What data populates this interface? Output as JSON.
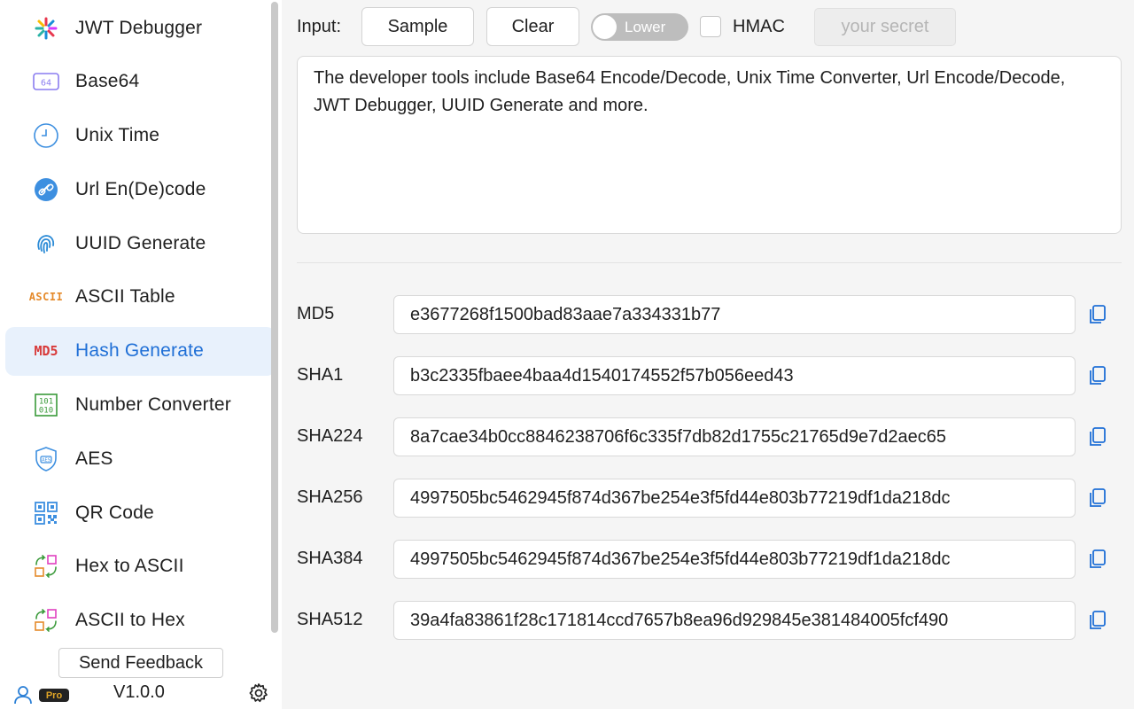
{
  "sidebar": {
    "items": [
      {
        "label": "JWT Debugger",
        "icon": "jwt-icon"
      },
      {
        "label": "Base64",
        "icon": "base64-icon"
      },
      {
        "label": "Unix Time",
        "icon": "clock-icon"
      },
      {
        "label": "Url En(De)code",
        "icon": "link-icon"
      },
      {
        "label": "UUID Generate",
        "icon": "fingerprint-icon"
      },
      {
        "label": "ASCII Table",
        "icon": "ascii-icon"
      },
      {
        "label": "Hash Generate",
        "icon": "md5-icon",
        "active": true
      },
      {
        "label": "Number Converter",
        "icon": "binary-icon"
      },
      {
        "label": "AES",
        "icon": "shield-icon"
      },
      {
        "label": "QR Code",
        "icon": "qr-icon"
      },
      {
        "label": "Hex to ASCII",
        "icon": "convert-icon"
      },
      {
        "label": "ASCII to Hex",
        "icon": "convert-icon"
      }
    ],
    "icon_text": {
      "base64": "64",
      "ascii": "ASCII",
      "md5": "MD5",
      "aes": "AES"
    },
    "feedback_label": "Send Feedback",
    "pro_badge": "Pro",
    "version": "V1.0.0"
  },
  "toolbar": {
    "input_label": "Input:",
    "sample_label": "Sample",
    "clear_label": "Clear",
    "case_toggle_label": "Lower",
    "hmac_label": "HMAC",
    "secret_placeholder": "your secret"
  },
  "input_text": "The developer tools include Base64 Encode/Decode, Unix Time Converter, Url Encode/Decode, JWT Debugger, UUID Generate and more.",
  "hashes": [
    {
      "label": "MD5",
      "value": "e3677268f1500bad83aae7a334331b77"
    },
    {
      "label": "SHA1",
      "value": "b3c2335fbaee4baa4d1540174552f57b056eed43"
    },
    {
      "label": "SHA224",
      "value": "8a7cae34b0cc8846238706f6c335f7db82d1755c21765d9e7d2aec65"
    },
    {
      "label": "SHA256",
      "value": "4997505bc5462945f874d367be254e3f5fd44e803b77219df1da218dc"
    },
    {
      "label": "SHA384",
      "value": "4997505bc5462945f874d367be254e3f5fd44e803b77219df1da218dc"
    },
    {
      "label": "SHA512",
      "value": "39a4fa83861f28c171814ccd7657b8ea96d929845e381484005fcf490"
    }
  ],
  "colors": {
    "accent": "#1f6fd6",
    "active_bg": "#e8f1fc",
    "copy_icon": "#1f6fd6"
  }
}
